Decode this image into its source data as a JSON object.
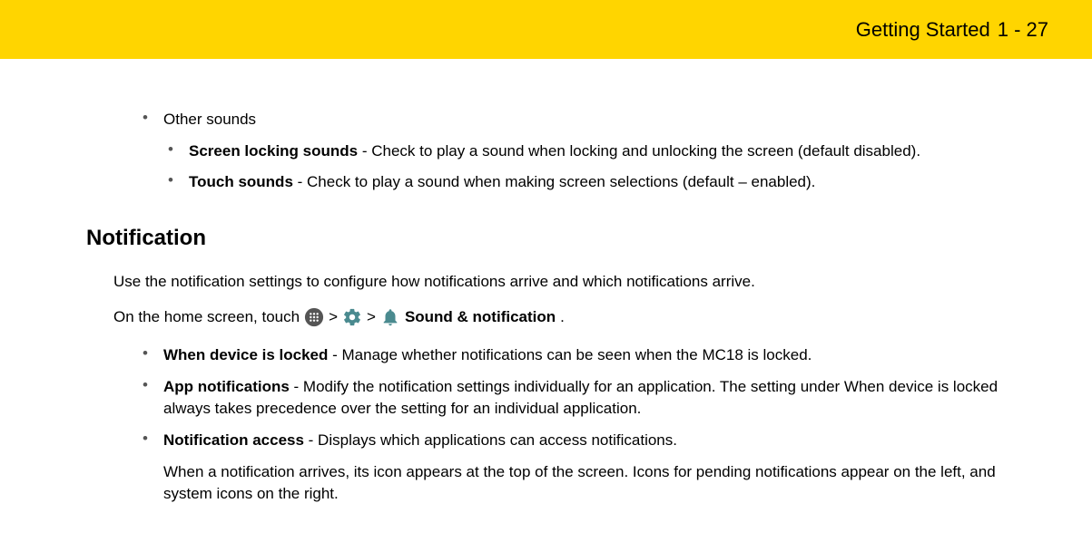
{
  "header": {
    "title": "Getting Started",
    "page": "1 - 27"
  },
  "sounds": {
    "other_label": "Other sounds",
    "screen_locking": {
      "label": "Screen locking sounds",
      "desc": " - Check to play a sound when locking and unlocking the screen (default disabled)."
    },
    "touch": {
      "label": "Touch sounds",
      "desc": " - Check to play a sound when making screen selections (default – enabled)."
    }
  },
  "notification": {
    "heading": "Notification",
    "intro": "Use the notification settings to configure how notifications arrive and which notifications arrive.",
    "path_prefix": "On the home screen, touch",
    "sep": ">",
    "sound_notif_label": "Sound & notification",
    "period": ".",
    "items": {
      "locked": {
        "label": "When device is locked",
        "desc": " - Manage whether notifications can be seen when the MC18 is locked."
      },
      "app": {
        "label": "App notifications",
        "desc": " - Modify the notification settings individually for an application. The setting under When device is locked always takes precedence over the setting for an individual application."
      },
      "access": {
        "label": "Notification access",
        "desc": " - Displays which applications can access notifications."
      }
    },
    "arrival_note": "When a notification arrives, its icon appears at the top of the screen. Icons for pending notifications appear on the left, and system icons on the right."
  }
}
